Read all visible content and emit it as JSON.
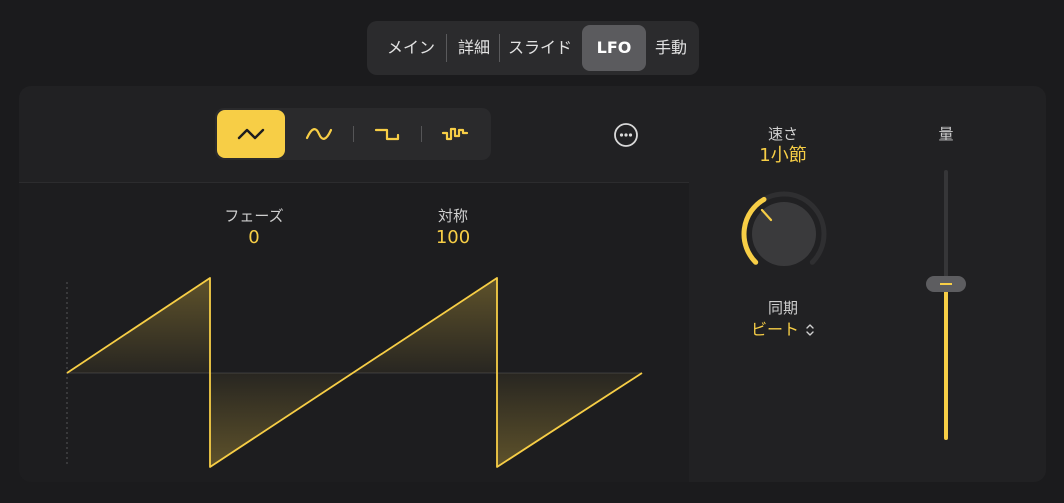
{
  "tabs": [
    {
      "label": "メイン",
      "active": false
    },
    {
      "label": "詳細",
      "active": false
    },
    {
      "label": "スライド",
      "active": false
    },
    {
      "label": "LFO",
      "active": true
    },
    {
      "label": "手動",
      "active": false
    }
  ],
  "shapes": [
    {
      "name": "triangle-wave",
      "active": true
    },
    {
      "name": "sine-wave",
      "active": false
    },
    {
      "name": "square-wave",
      "active": false
    },
    {
      "name": "random-wave",
      "active": false
    }
  ],
  "params": {
    "phase": {
      "label": "フェーズ",
      "value": "0"
    },
    "symmetry": {
      "label": "対称",
      "value": "100"
    }
  },
  "rate": {
    "label": "速さ",
    "value": "1小節"
  },
  "sync": {
    "label": "同期",
    "value": "ビート"
  },
  "amount": {
    "label": "量",
    "level_fraction": 0.57
  },
  "colors": {
    "accent": "#f7ce46",
    "background": "#1b1b1d",
    "panel": "#212123",
    "tab_active": "#5b5b5e"
  }
}
